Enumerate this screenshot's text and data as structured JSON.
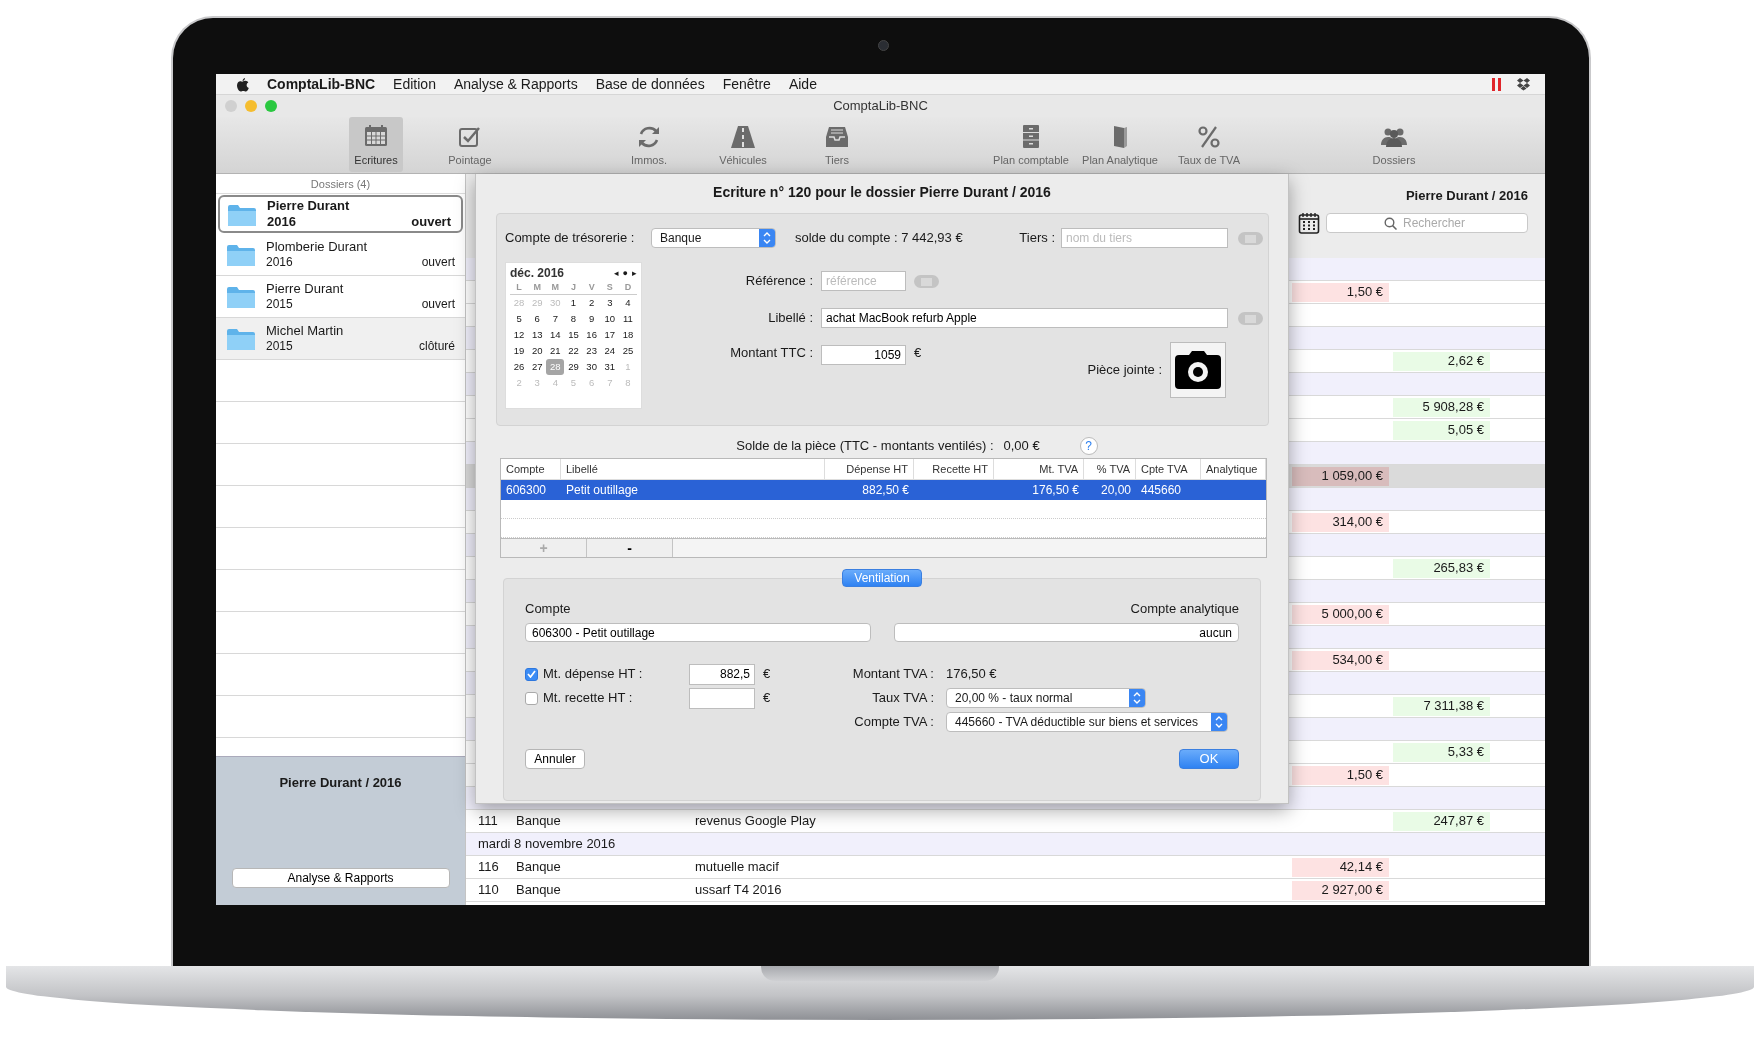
{
  "menubar": {
    "app": "ComptaLib-BNC",
    "menus": [
      "Edition",
      "Analyse & Rapports",
      "Base de données",
      "Fenêtre",
      "Aide"
    ]
  },
  "window": {
    "title": "ComptaLib-BNC"
  },
  "toolbar": [
    {
      "items": [
        {
          "label": "Ecritures",
          "selected": true
        },
        {
          "label": "Pointage",
          "selected": false
        }
      ]
    },
    {
      "items": [
        {
          "label": "Immos.",
          "selected": false
        },
        {
          "label": "Véhicules",
          "selected": false
        },
        {
          "label": "Tiers",
          "selected": false
        }
      ]
    },
    {
      "items": [
        {
          "label": "Plan comptable",
          "selected": false
        },
        {
          "label": "Plan Analytique",
          "selected": false
        },
        {
          "label": "Taux de TVA",
          "selected": false
        }
      ]
    },
    {
      "items": [
        {
          "label": "Dossiers",
          "selected": false
        }
      ]
    }
  ],
  "sidebar": {
    "header": "Dossiers (4)",
    "items": [
      {
        "name": "Pierre Durant",
        "year": "2016",
        "status": "ouvert",
        "selected": true,
        "highlighted": false
      },
      {
        "name": "Plomberie Durant",
        "year": "2016",
        "status": "ouvert",
        "selected": false,
        "highlighted": false
      },
      {
        "name": "Pierre Durant",
        "year": "2015",
        "status": "ouvert",
        "selected": false,
        "highlighted": false
      },
      {
        "name": "Michel Martin",
        "year": "2015",
        "status": "clôturé",
        "selected": false,
        "highlighted": true
      }
    ],
    "footer": {
      "title": "Pierre Durant / 2016",
      "button": "Analyse & Rapports"
    }
  },
  "main": {
    "title": "Pierre Durant / 2016",
    "search": {
      "placeholder": "Rechercher"
    },
    "rows": [
      {
        "kind": "date"
      },
      {
        "kind": "entry",
        "expense": "1,50 €",
        "selected": false
      },
      {
        "kind": "entry",
        "selected": false
      },
      {
        "kind": "date"
      },
      {
        "kind": "entry",
        "income": "2,62 €",
        "selected": false
      },
      {
        "kind": "date"
      },
      {
        "kind": "entry",
        "income": "5 908,28 €",
        "selected": false
      },
      {
        "kind": "entry",
        "income": "5,05 €",
        "selected": false
      },
      {
        "kind": "date"
      },
      {
        "kind": "entry",
        "expense": "1 059,00 €",
        "selected": true
      },
      {
        "kind": "date"
      },
      {
        "kind": "entry",
        "expense": "314,00 €",
        "selected": false
      },
      {
        "kind": "date"
      },
      {
        "kind": "entry",
        "income": "265,83 €",
        "selected": false
      },
      {
        "kind": "date"
      },
      {
        "kind": "entry",
        "expense": "5 000,00 €",
        "selected": false
      },
      {
        "kind": "date"
      },
      {
        "kind": "entry",
        "expense": "534,00 €",
        "selected": false
      },
      {
        "kind": "date"
      },
      {
        "kind": "entry",
        "income": "7 311,38 €",
        "selected": false
      },
      {
        "kind": "date"
      },
      {
        "kind": "entry",
        "income": "5,33 €",
        "selected": false
      },
      {
        "kind": "entry",
        "expense": "1,50 €",
        "selected": false
      },
      {
        "kind": "date"
      },
      {
        "kind": "entry",
        "number": "111",
        "account": "Banque",
        "label": "revenus Google Play",
        "income": "247,87 €",
        "selected": false
      },
      {
        "kind": "date",
        "text": "mardi 8 novembre 2016"
      },
      {
        "kind": "entry",
        "number": "116",
        "account": "Banque",
        "label": "mutuelle macif",
        "expense": "42,14 €",
        "selected": false
      },
      {
        "kind": "entry",
        "number": "110",
        "account": "Banque",
        "label": "ussarf T4 2016",
        "expense": "2 927,00 €",
        "selected": false
      }
    ]
  },
  "dialog": {
    "title": "Ecriture n° 120 pour le dossier Pierre Durant / 2016",
    "treasury": {
      "label": "Compte de trésorerie :",
      "value": "Banque"
    },
    "balance": "solde du compte : 7 442,93 €",
    "third_party": {
      "label": "Tiers :",
      "placeholder": "nom du tiers"
    },
    "calendar": {
      "month": "déc. 2016",
      "nav": [
        "◂",
        "●",
        "▸"
      ],
      "weekdays": [
        "L",
        "M",
        "M",
        "J",
        "V",
        "S",
        "D"
      ],
      "days": [
        {
          "day": "28",
          "other_month": true,
          "selected": false
        },
        {
          "day": "29",
          "other_month": true,
          "selected": false
        },
        {
          "day": "30",
          "other_month": true,
          "selected": false
        },
        {
          "day": "1",
          "other_month": false,
          "selected": false
        },
        {
          "day": "2",
          "other_month": false,
          "selected": false
        },
        {
          "day": "3",
          "other_month": false,
          "selected": false
        },
        {
          "day": "4",
          "other_month": false,
          "selected": false
        },
        {
          "day": "5",
          "other_month": false,
          "selected": false
        },
        {
          "day": "6",
          "other_month": false,
          "selected": false
        },
        {
          "day": "7",
          "other_month": false,
          "selected": false
        },
        {
          "day": "8",
          "other_month": false,
          "selected": false
        },
        {
          "day": "9",
          "other_month": false,
          "selected": false
        },
        {
          "day": "10",
          "other_month": false,
          "selected": false
        },
        {
          "day": "11",
          "other_month": false,
          "selected": false
        },
        {
          "day": "12",
          "other_month": false,
          "selected": false
        },
        {
          "day": "13",
          "other_month": false,
          "selected": false
        },
        {
          "day": "14",
          "other_month": false,
          "selected": false
        },
        {
          "day": "15",
          "other_month": false,
          "selected": false
        },
        {
          "day": "16",
          "other_month": false,
          "selected": false
        },
        {
          "day": "17",
          "other_month": false,
          "selected": false
        },
        {
          "day": "18",
          "other_month": false,
          "selected": false
        },
        {
          "day": "19",
          "other_month": false,
          "selected": false
        },
        {
          "day": "20",
          "other_month": false,
          "selected": false
        },
        {
          "day": "21",
          "other_month": false,
          "selected": false
        },
        {
          "day": "22",
          "other_month": false,
          "selected": false
        },
        {
          "day": "23",
          "other_month": false,
          "selected": false
        },
        {
          "day": "24",
          "other_month": false,
          "selected": false
        },
        {
          "day": "25",
          "other_month": false,
          "selected": false
        },
        {
          "day": "26",
          "other_month": false,
          "selected": false
        },
        {
          "day": "27",
          "other_month": false,
          "selected": false
        },
        {
          "day": "28",
          "other_month": false,
          "selected": true
        },
        {
          "day": "29",
          "other_month": false,
          "selected": false
        },
        {
          "day": "30",
          "other_month": false,
          "selected": false
        },
        {
          "day": "31",
          "other_month": false,
          "selected": false
        },
        {
          "day": "1",
          "other_month": true,
          "selected": false
        },
        {
          "day": "2",
          "other_month": true,
          "selected": false
        },
        {
          "day": "3",
          "other_month": true,
          "selected": false
        },
        {
          "day": "4",
          "other_month": true,
          "selected": false
        },
        {
          "day": "5",
          "other_month": true,
          "selected": false
        },
        {
          "day": "6",
          "other_month": true,
          "selected": false
        },
        {
          "day": "7",
          "other_month": true,
          "selected": false
        },
        {
          "day": "8",
          "other_month": true,
          "selected": false
        }
      ]
    },
    "reference": {
      "label": "Référence :",
      "placeholder": "référence"
    },
    "description": {
      "label": "Libellé :",
      "value": "achat MacBook refurb Apple"
    },
    "amount": {
      "label": "Montant TTC :",
      "value": "1059",
      "unit": "€"
    },
    "attachment": {
      "label": "Pièce jointe :"
    },
    "remainder": {
      "label": "Solde de la pièce (TTC - montants ventilés) :",
      "value": "0,00 €",
      "help": "?"
    },
    "table": {
      "columns": [
        "Compte",
        "Libellé",
        "Dépense HT",
        "Recette HT",
        "Mt. TVA",
        "% TVA",
        "Cpte TVA",
        "Analytique"
      ],
      "rows": [
        {
          "account": "606300",
          "label": "Petit outillage",
          "expense": "882,50 €",
          "vat_amount": "176,50 €",
          "vat_rate": "20,00",
          "vat_account": "445660",
          "selected": true
        }
      ],
      "add": {
        "label": "+",
        "disabled": true
      },
      "remove": {
        "label": "-",
        "disabled": false
      }
    },
    "tab": "Ventilation",
    "allocation": {
      "account_label": "Compte",
      "account": "606300 - Petit outillage",
      "analytic_label": "Compte analytique",
      "analytic": "aucun",
      "expense": {
        "label": "Mt. dépense HT :",
        "checked": true,
        "value": "882,5",
        "unit": "€"
      },
      "income": {
        "label": "Mt. recette HT :",
        "checked": false,
        "unit": "€"
      },
      "vat_amount": {
        "label": "Montant TVA :",
        "value": "176,50 €"
      },
      "vat_rate": {
        "label": "Taux TVA :",
        "value": "20,00 % - taux normal"
      },
      "vat_account": {
        "label": "Compte TVA :",
        "value": "445660 - TVA déductible sur biens et services"
      }
    },
    "buttons": {
      "cancel": "Annuler",
      "ok": "OK"
    }
  }
}
